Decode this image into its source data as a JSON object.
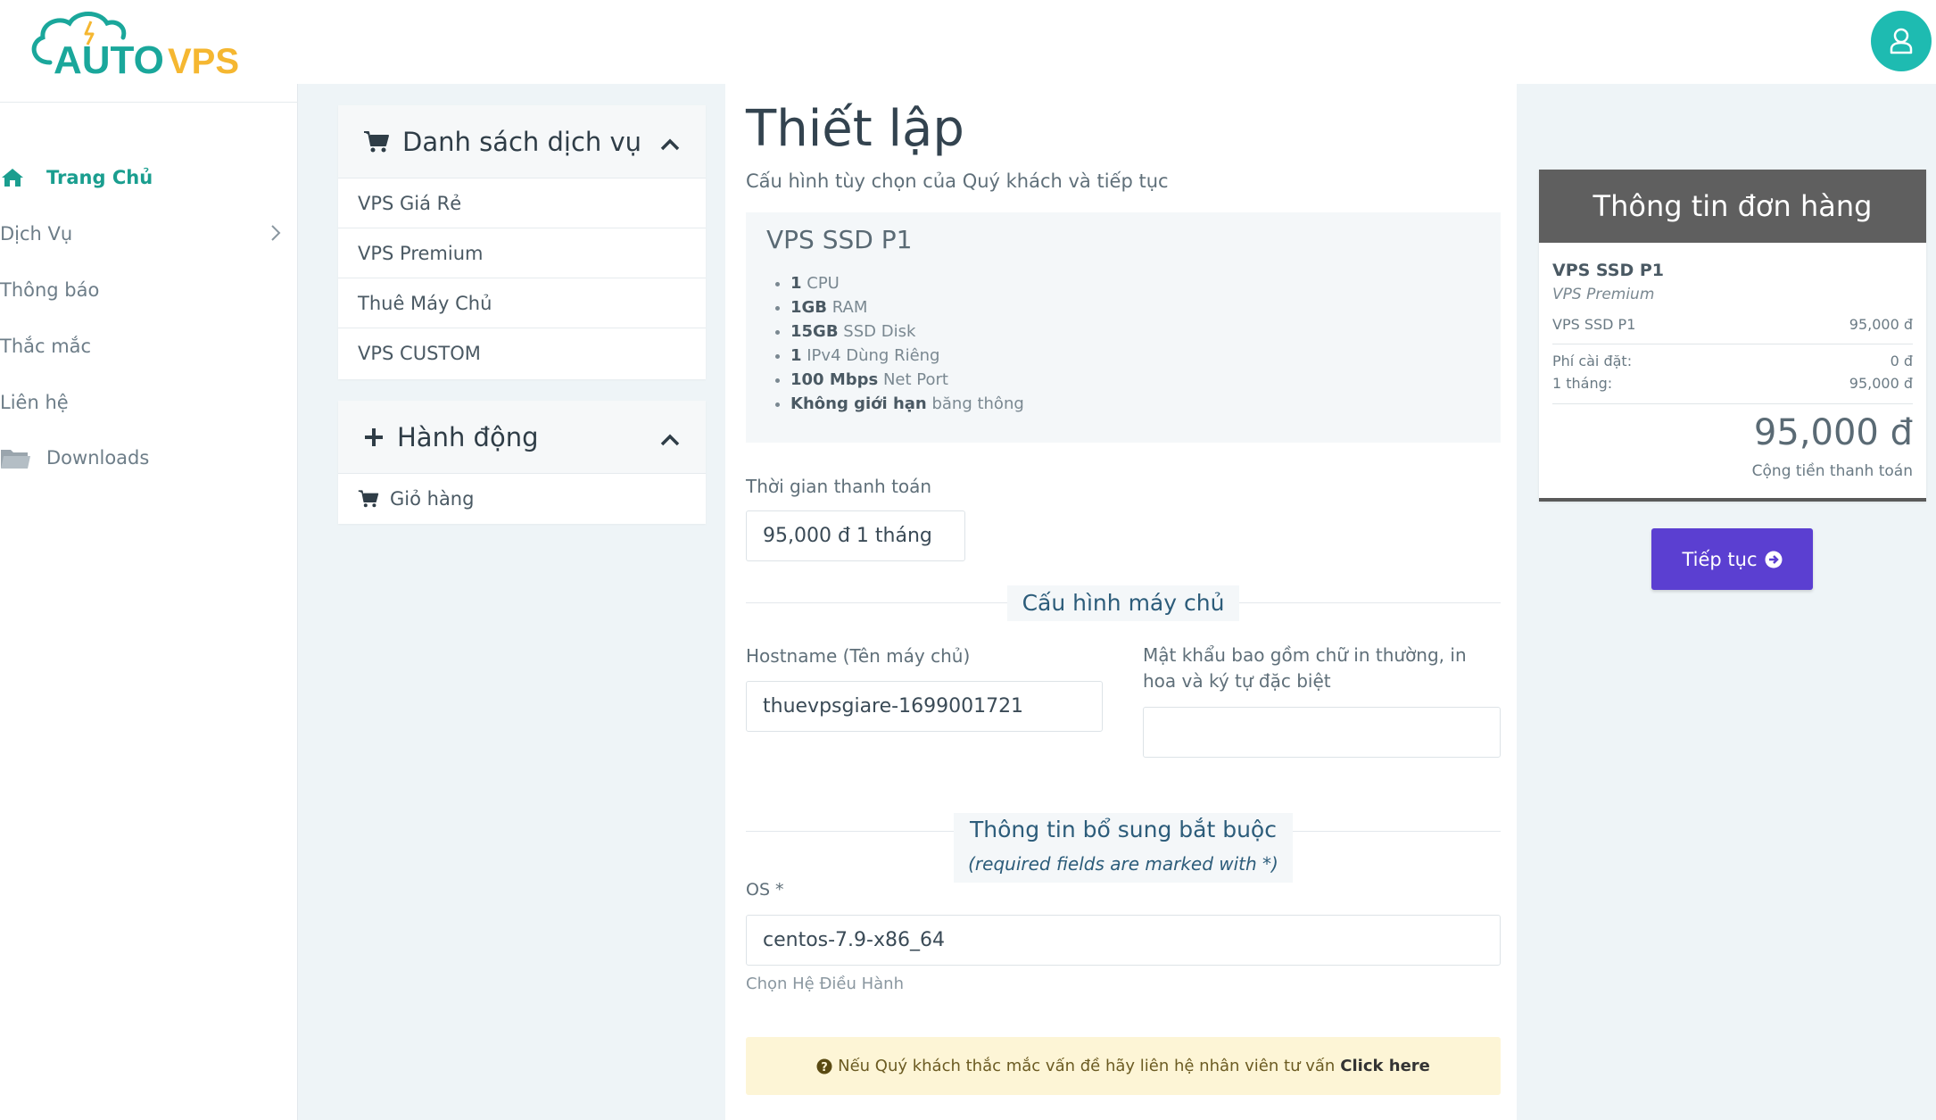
{
  "header": {
    "logo": {
      "part1": "AUTO",
      "part2": "VPS"
    },
    "user_icon": "user-icon"
  },
  "sidebar": {
    "items": [
      {
        "label": "Trang Chủ",
        "icon": "home-icon",
        "active": true
      },
      {
        "label": "Dịch Vụ",
        "icon": "",
        "chevron": true
      },
      {
        "label": "Thông báo",
        "icon": ""
      },
      {
        "label": "Thắc mắc",
        "icon": ""
      },
      {
        "label": "Liên hệ",
        "icon": ""
      },
      {
        "label": "Downloads",
        "icon": "folder-icon"
      }
    ]
  },
  "services_card": {
    "title": "Danh sách dịch vụ",
    "items": [
      "VPS Giá Rẻ",
      "VPS Premium",
      "Thuê Máy Chủ",
      "VPS CUSTOM"
    ]
  },
  "actions_card": {
    "title": "Hành động",
    "items": [
      "Giỏ hàng"
    ]
  },
  "main": {
    "title": "Thiết lập",
    "subtitle": "Cấu hình tùy chọn của Quý khách và tiếp tục",
    "product": {
      "name": "VPS SSD P1",
      "specs": [
        {
          "bold": "1",
          "text": " CPU"
        },
        {
          "bold": "1GB",
          "text": " RAM"
        },
        {
          "bold": "15GB",
          "text": " SSD Disk"
        },
        {
          "bold": "1",
          "text": " IPv4 Dùng Riêng"
        },
        {
          "bold": "100 Mbps",
          "text": " Net Port"
        },
        {
          "bold": "Không giới hạn",
          "text": " băng thông"
        }
      ]
    },
    "billing_label": "Thời gian thanh toán",
    "billing_value": "95,000 đ 1 tháng",
    "server_config_title": "Cấu hình máy chủ",
    "hostname_label": "Hostname (Tên máy chủ)",
    "hostname_value": "thuevpsgiare-1699001721",
    "password_label_1": "Mật khẩu bao gồm chữ in thường, in",
    "password_label_2": "hoa và ký tự đặc biệt",
    "password_value": "",
    "extra_title": "Thông tin bổ sung bắt buộc",
    "extra_sub": "(required fields are marked with *)",
    "os_label": "OS *",
    "os_value": "centos-7.9-x86_64",
    "os_help": "Chọn Hệ Điều Hành",
    "alert_text": "Nếu Quý khách thắc mắc vấn đề hãy liên hệ nhân viên tư vấn",
    "alert_link": "Click here"
  },
  "order": {
    "title": "Thông tin đơn hàng",
    "product_name": "VPS SSD P1",
    "product_group": "VPS Premium",
    "line_item": {
      "label": "VPS SSD P1",
      "value": "95,000 đ"
    },
    "setup_fee": {
      "label": "Phí cài đặt:",
      "value": "0 đ"
    },
    "monthly": {
      "label": "1 tháng:",
      "value": "95,000 đ"
    },
    "total": "95,000 đ",
    "total_label": "Cộng tiền thanh toán"
  },
  "continue_button": "Tiếp tục",
  "colors": {
    "accent": "#1a9e8f",
    "button": "#5b3fd1",
    "order_head": "#5f5f5f",
    "logo_yellow": "#f5b731",
    "logo_teal": "#1ebbb1"
  }
}
